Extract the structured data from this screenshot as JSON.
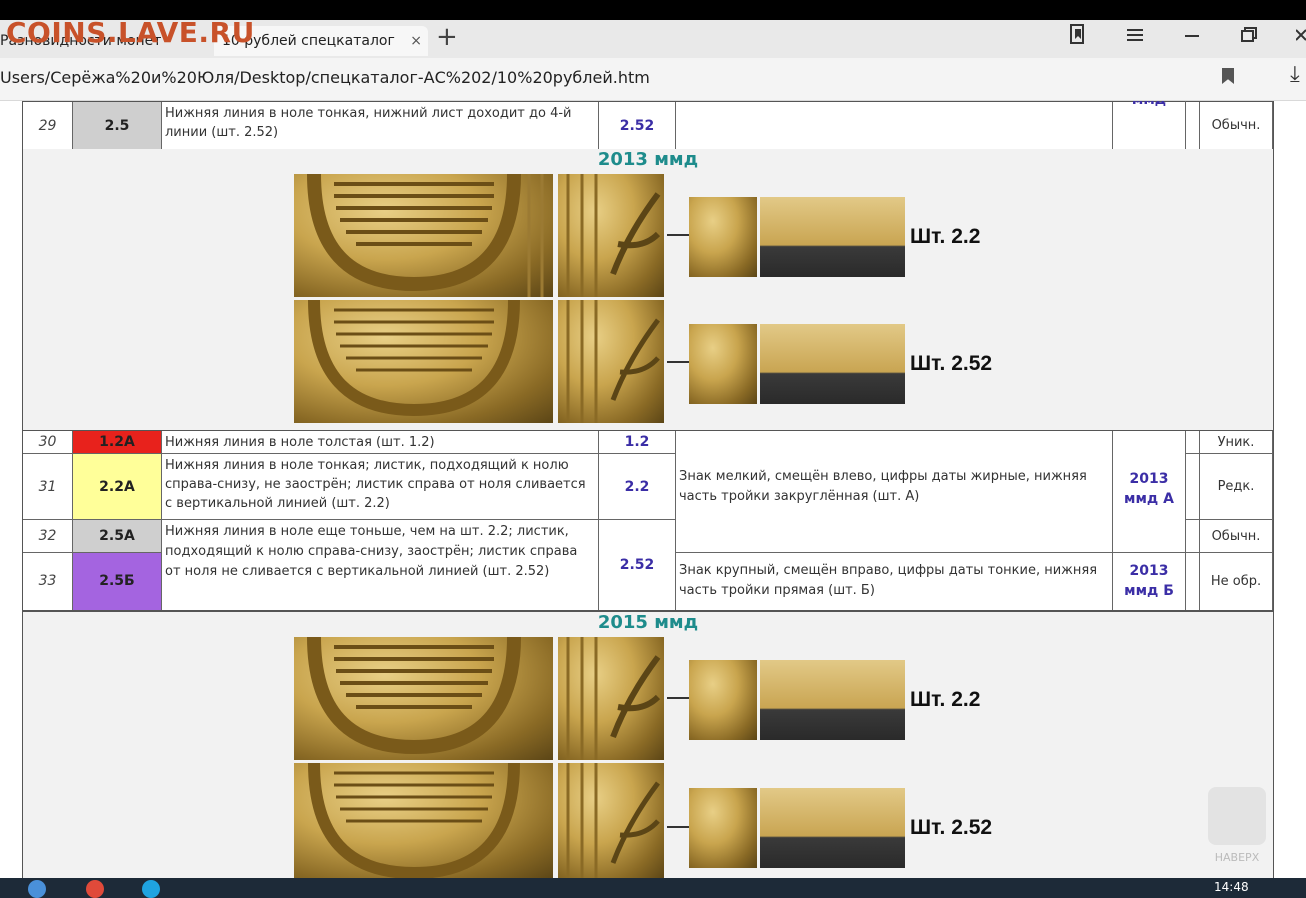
{
  "watermark": "COINS.LAVE.RU",
  "browser": {
    "tab1": "Разновидности монет",
    "tab2": "10 рублей спецкаталог",
    "tab_close": "×",
    "new_tab": "+",
    "url": "Users/Серёжа%20и%20Юля/Desktop/спецкаталог-АС%202/10%20рублей.htm"
  },
  "rows_top": {
    "r29": {
      "num": "29",
      "code": "2.5",
      "desc": "Нижняя линия в ноле тонкая, нижний лист доходит до 4-й линии (шт. 2.52)",
      "sht": "2.52",
      "year": "ммд",
      "rarity": "Обычн."
    }
  },
  "section_2013": {
    "title": "2013 ммд",
    "label_a": "Шт. 2.2",
    "label_b": "Шт. 2.52"
  },
  "rows_mid": {
    "r30": {
      "num": "30",
      "code": "1.2А",
      "desc": "Нижняя линия в ноле толстая (шт. 1.2)",
      "sht": "1.2",
      "rarity": "Уник."
    },
    "r31": {
      "num": "31",
      "code": "2.2А",
      "desc": "Нижняя линия в ноле тонкая; листик, подходящий к нолю справа-снизу, не заострён; листик справа от ноля сливается с вертикальной линией (шт. 2.2)",
      "sht": "2.2",
      "rarity": "Редк."
    },
    "groupA": {
      "znak": "Знак мелкий, смещён влево, цифры даты жирные, нижняя часть тройки закруглённая (шт. А)",
      "year": "2013",
      "mint": "ммд А"
    },
    "r32": {
      "num": "32",
      "code": "2.5А",
      "rarity": "Обычн."
    },
    "r33": {
      "num": "33",
      "code": "2.5Б",
      "rarity": "Не обр."
    },
    "desc3233": "Нижняя линия в ноле еще тоньше, чем на шт. 2.2; листик, подходящий к нолю справа-снизу, заострён; листик справа от ноля не сливается с вертикальной линией (шт. 2.52)",
    "sht3233": "2.52",
    "groupB": {
      "znak": "Знак крупный, смещён вправо, цифры даты тонкие, нижняя часть тройки прямая (шт. Б)",
      "year": "2013",
      "mint": "ммд Б"
    }
  },
  "section_2015": {
    "title": "2015 ммд",
    "label_a": "Шт. 2.2",
    "label_b": "Шт. 2.52"
  },
  "to_top": "НАВЕРХ",
  "taskbar": {
    "clock": "14:48"
  },
  "colors": {
    "code_1_2A": "#e8221c",
    "code_2_2A": "#ffff99",
    "code_2_5A": "#cfcfcf",
    "code_2_5B": "#a464e0",
    "code_2_5": "#cfcfcf",
    "section_title": "#1e8c8c",
    "sht_link": "#3b2ea6"
  }
}
